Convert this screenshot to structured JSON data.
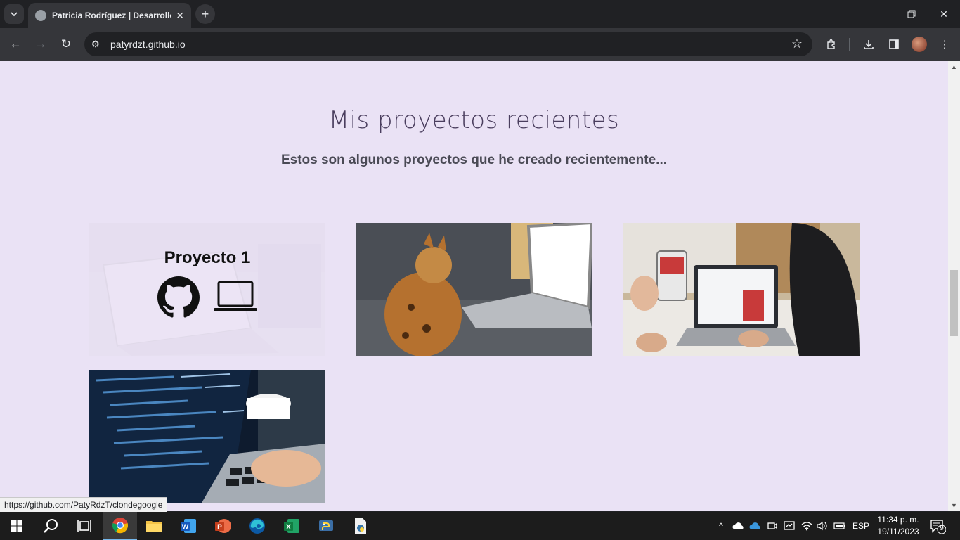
{
  "browser": {
    "tab_title": "Patricia Rodríguez | Desarrollo",
    "url": "patyrdzt.github.io",
    "status_url": "https://github.com/PatyRdzT/clondegoogle"
  },
  "page": {
    "section_title": "Mis proyectos recientes",
    "section_subtitle": "Estos son algunos proyectos que he creado recientemente...",
    "projects": [
      {
        "title": "Proyecto 1",
        "hover": true
      },
      {
        "title": ""
      },
      {
        "title": ""
      },
      {
        "title": ""
      }
    ]
  },
  "taskbar": {
    "language": "ESP",
    "time": "11:34 p. m.",
    "date": "19/11/2023",
    "notifications": "9",
    "apps": [
      "chrome-icon",
      "file-explorer-icon",
      "word-icon",
      "powerpoint-icon",
      "edge-icon",
      "excel-icon",
      "python-icon",
      "python-file-icon"
    ]
  },
  "colors": {
    "page_bg": "#eae2f5",
    "chrome_dark": "#202124",
    "chrome_toolbar": "#35363a"
  }
}
